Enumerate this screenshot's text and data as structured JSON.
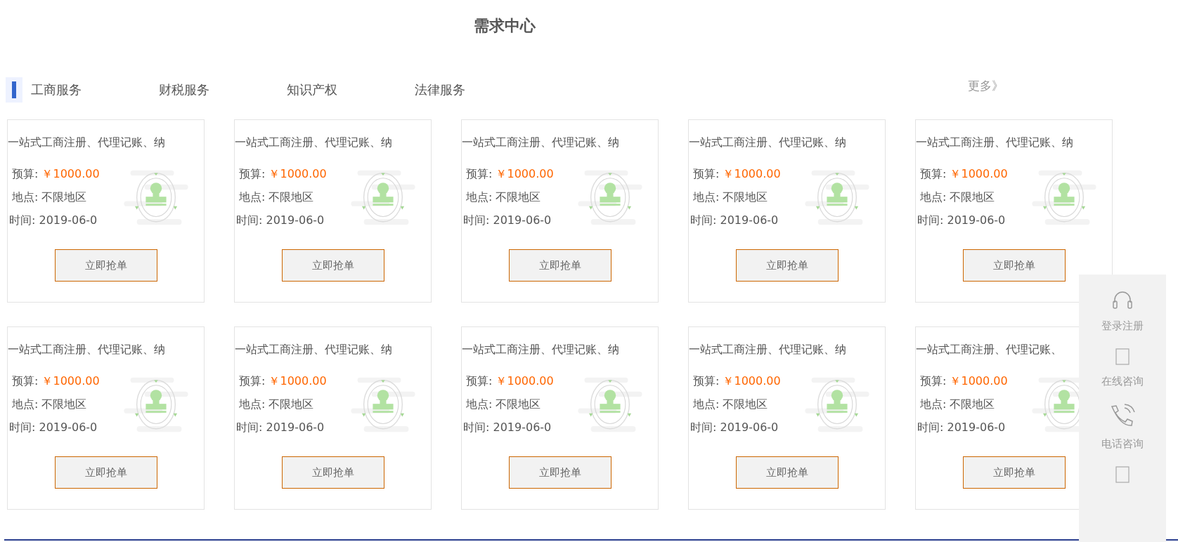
{
  "title": "需求中心",
  "tabs": [
    {
      "label": "工商服务",
      "selected": true
    },
    {
      "label": "财税服务",
      "selected": false
    },
    {
      "label": "知识产权",
      "selected": false
    },
    {
      "label": "法律服务",
      "selected": false
    }
  ],
  "more_link": "更多》",
  "cards": [
    {
      "title": "一站式工商注册、代理记账、纳",
      "budget_label": "预算:",
      "budget": "￥1000.00",
      "location": "地点: 不限地区",
      "time": "时间: 2019-06-0",
      "button": "立即抢单"
    },
    {
      "title": "一站式工商注册、代理记账、纳",
      "budget_label": "预算:",
      "budget": "￥1000.00",
      "location": "地点: 不限地区",
      "time": "时间: 2019-06-0",
      "button": "立即抢单"
    },
    {
      "title": "一站式工商注册、代理记账、纳",
      "budget_label": "预算:",
      "budget": "￥1000.00",
      "location": "地点: 不限地区",
      "time": "时间: 2019-06-0",
      "button": "立即抢单"
    },
    {
      "title": "一站式工商注册、代理记账、纳",
      "budget_label": "预算:",
      "budget": "￥1000.00",
      "location": "地点: 不限地区",
      "time": "时间: 2019-06-0",
      "button": "立即抢单"
    },
    {
      "title": "一站式工商注册、代理记账、纳",
      "budget_label": "预算:",
      "budget": "￥1000.00",
      "location": "地点: 不限地区",
      "time": "时间: 2019-06-0",
      "button": "立即抢单"
    },
    {
      "title": "一站式工商注册、代理记账、纳",
      "budget_label": "预算:",
      "budget": "￥1000.00",
      "location": "地点: 不限地区",
      "time": "时间: 2019-06-0",
      "button": "立即抢单"
    },
    {
      "title": "一站式工商注册、代理记账、纳",
      "budget_label": "预算:",
      "budget": "￥1000.00",
      "location": "地点: 不限地区",
      "time": "时间: 2019-06-0",
      "button": "立即抢单"
    },
    {
      "title": "一站式工商注册、代理记账、纳",
      "budget_label": "预算:",
      "budget": "￥1000.00",
      "location": "地点: 不限地区",
      "time": "时间: 2019-06-0",
      "button": "立即抢单"
    },
    {
      "title": "一站式工商注册、代理记账、纳",
      "budget_label": "预算:",
      "budget": "￥1000.00",
      "location": "地点: 不限地区",
      "time": "时间: 2019-06-0",
      "button": "立即抢单"
    },
    {
      "title": "一站式工商注册、代理记账、",
      "budget_label": "预算:",
      "budget": "￥1000.00",
      "location": "地点: 不限地区",
      "time": "时间: 2019-06-0",
      "button": "立即抢单"
    }
  ],
  "sidebar": [
    {
      "kind": "headset",
      "label": "登录注册"
    },
    {
      "kind": "box",
      "label": "在线咨询"
    },
    {
      "kind": "phone",
      "label": "电话咨询"
    },
    {
      "kind": "box"
    }
  ]
}
